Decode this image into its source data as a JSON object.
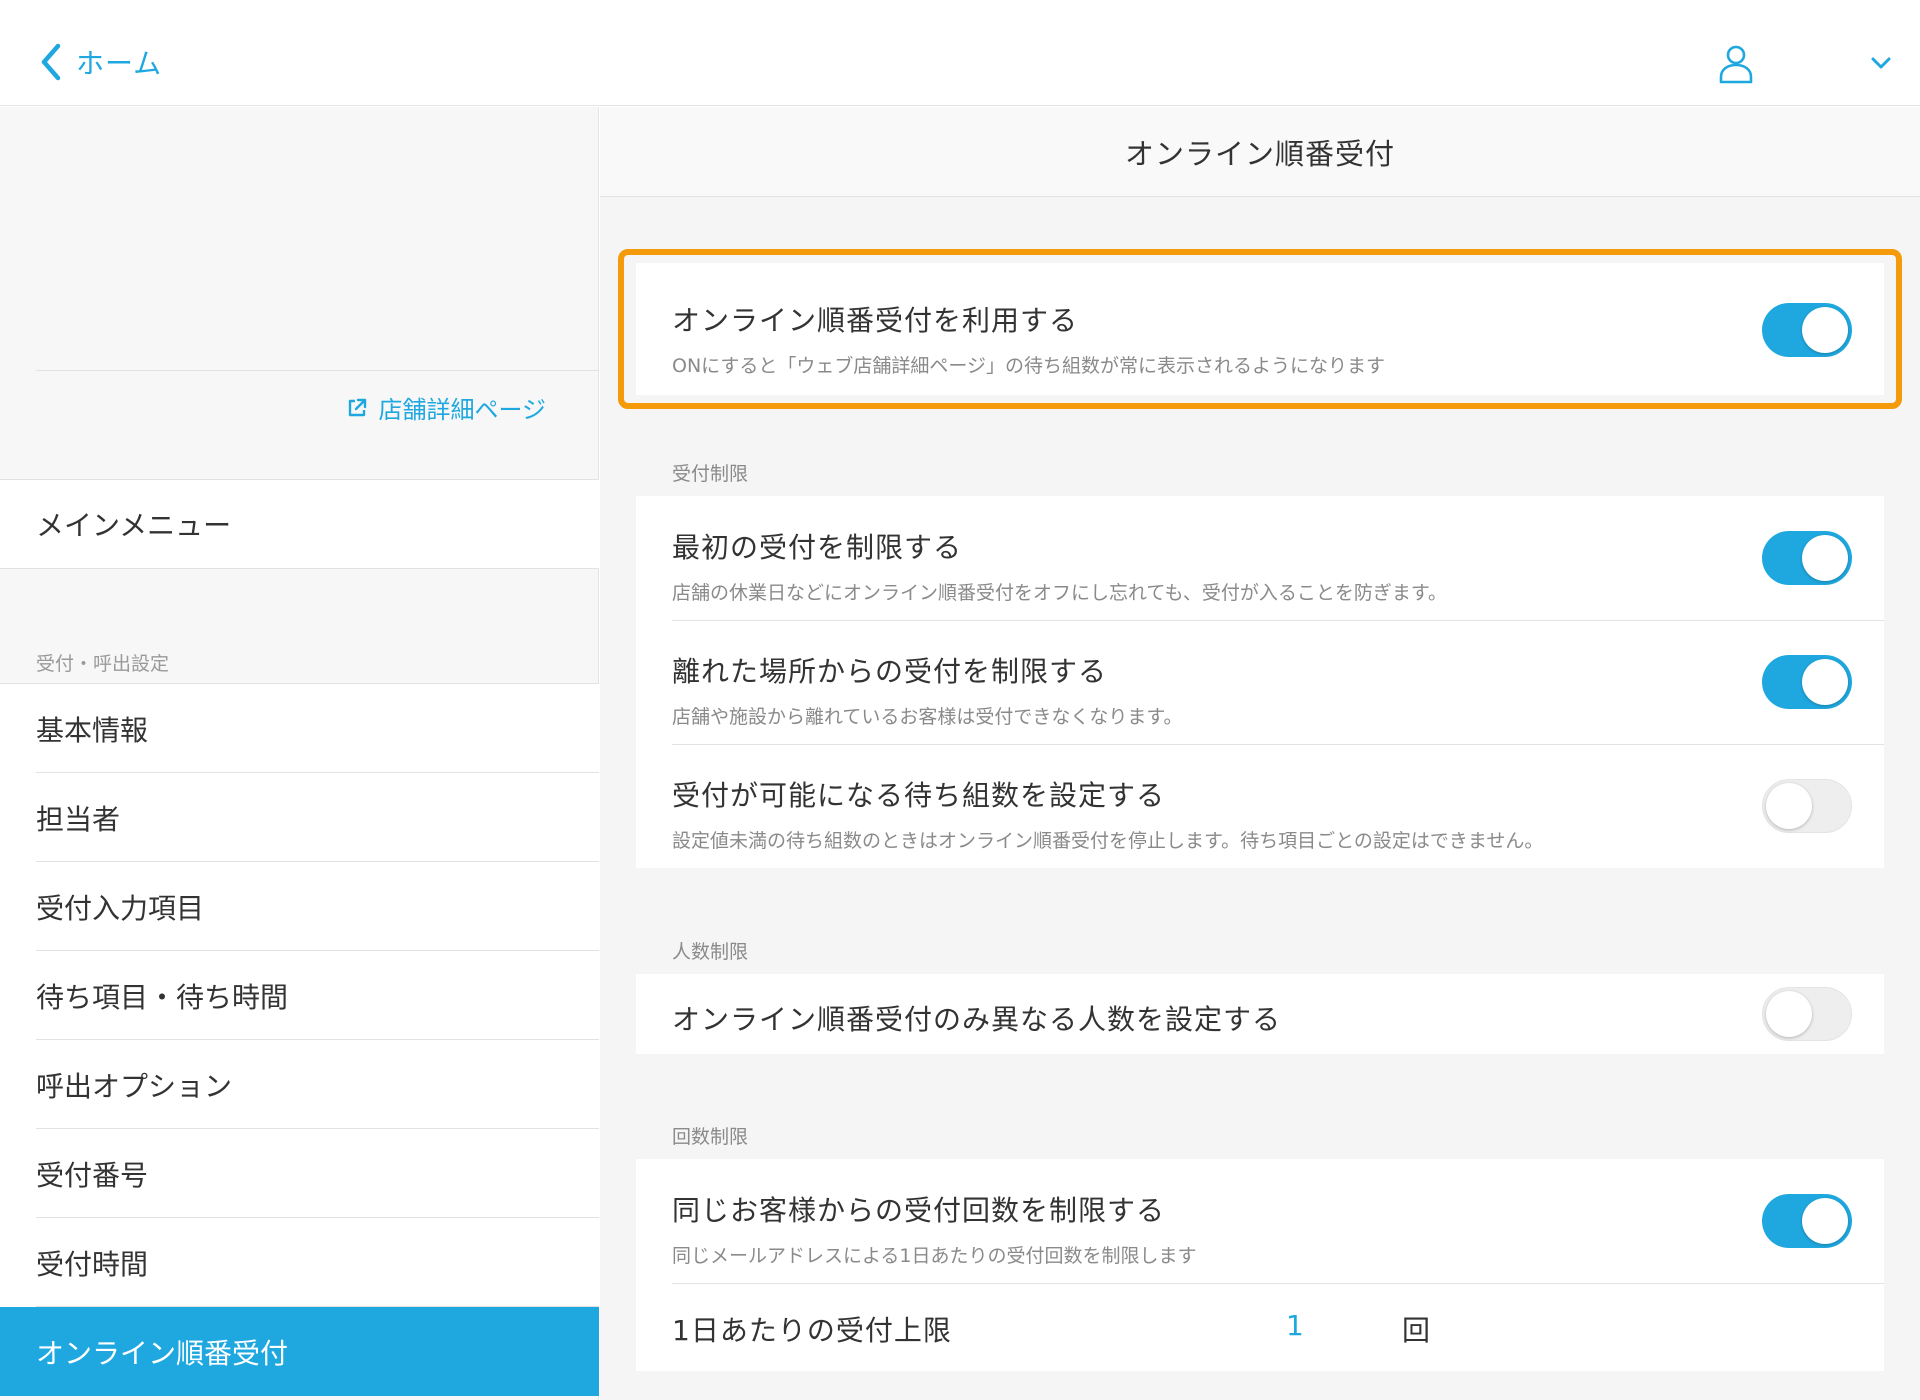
{
  "header": {
    "back_label": "ホーム",
    "user_icon": "user-icon",
    "menu_icon": "chevron-down-icon"
  },
  "sidebar": {
    "shop_link": "店舗詳細ページ",
    "main_menu": "メインメニュー",
    "section_label": "受付・呼出設定",
    "items": [
      {
        "label": "基本情報"
      },
      {
        "label": "担当者"
      },
      {
        "label": "受付入力項目"
      },
      {
        "label": "待ち項目・待ち時間"
      },
      {
        "label": "呼出オプション"
      },
      {
        "label": "受付番号"
      },
      {
        "label": "受付時間"
      },
      {
        "label": "オンライン順番受付"
      }
    ],
    "active_item": "オンライン順番受付"
  },
  "main": {
    "title": "オンライン順番受付",
    "use_online": {
      "title": "オンライン順番受付を利用する",
      "desc": "ONにすると「ウェブ店舗詳細ページ」の待ち組数が常に表示されるようになります",
      "on": true
    },
    "sections": {
      "reception_limit": {
        "label": "受付制限",
        "rows": [
          {
            "title": "最初の受付を制限する",
            "desc": "店舗の休業日などにオンライン順番受付をオフにし忘れても、受付が入ることを防ぎます。",
            "on": true
          },
          {
            "title": "離れた場所からの受付を制限する",
            "desc": "店舗や施設から離れているお客様は受付できなくなります。",
            "on": true
          },
          {
            "title": "受付が可能になる待ち組数を設定する",
            "desc": "設定値未満の待ち組数のときはオンライン順番受付を停止します。待ち項目ごとの設定はできません。",
            "on": false
          }
        ]
      },
      "people_limit": {
        "label": "人数制限",
        "rows": [
          {
            "title": "オンライン順番受付のみ異なる人数を設定する",
            "on": false
          }
        ]
      },
      "count_limit": {
        "label": "回数制限",
        "rows": [
          {
            "title": "同じお客様からの受付回数を制限する",
            "desc": "同じメールアドレスによる1日あたりの受付回数を制限します",
            "on": true
          }
        ],
        "daily_limit": {
          "label": "1日あたりの受付上限",
          "value": "1",
          "unit": "回"
        }
      }
    }
  },
  "colors": {
    "accent": "#1fa8e0",
    "highlight": "#f59a0a",
    "toggle_off": "#eeeeee"
  }
}
